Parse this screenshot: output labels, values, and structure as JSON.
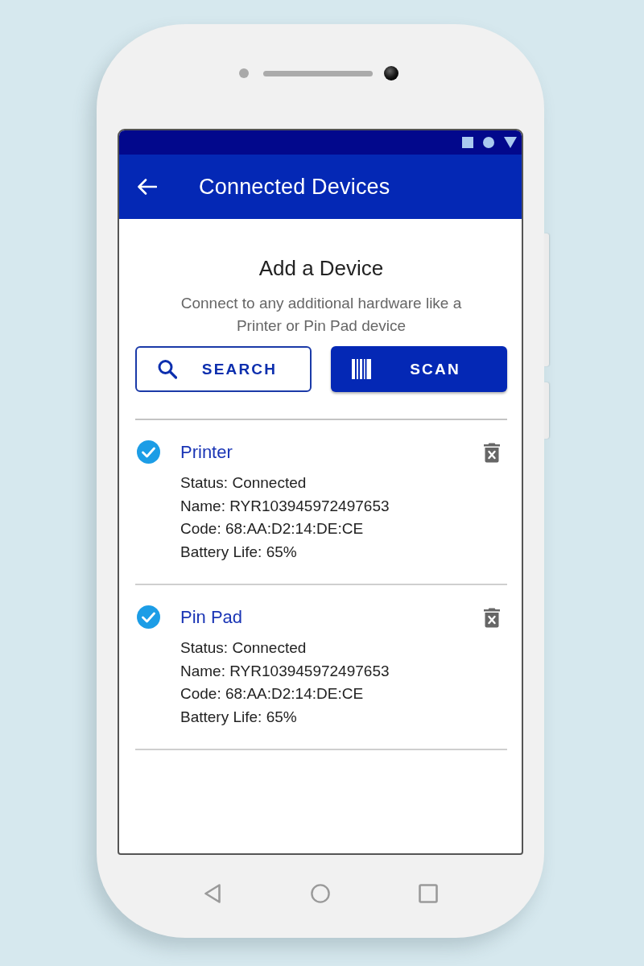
{
  "app_bar": {
    "title": "Connected Devices"
  },
  "add_device": {
    "heading": "Add a Device",
    "description": "Connect to any additional hardware like a Printer or Pin Pad device",
    "search_button": {
      "label": "SEARCH"
    },
    "scan_button": {
      "label": "SCAN"
    }
  },
  "devices": [
    {
      "name": "Printer",
      "checked": true,
      "details": [
        "Status: Connected",
        "Name: RYR103945972497653",
        "Code: 68:AA:D2:14:DE:CE",
        "Battery Life: 65%"
      ]
    },
    {
      "name": "Pin Pad",
      "checked": true,
      "details": [
        "Status: Connected",
        "Name: RYR103945972497653",
        "Code: 68:AA:D2:14:DE:CE",
        "Battery Life: 65%"
      ]
    }
  ]
}
